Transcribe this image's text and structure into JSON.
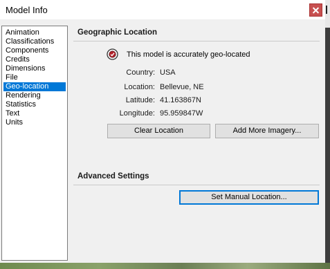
{
  "window": {
    "title": "Model Info"
  },
  "sidebar": {
    "items": [
      {
        "label": "Animation",
        "selected": false
      },
      {
        "label": "Classifications",
        "selected": false
      },
      {
        "label": "Components",
        "selected": false
      },
      {
        "label": "Credits",
        "selected": false
      },
      {
        "label": "Dimensions",
        "selected": false
      },
      {
        "label": "File",
        "selected": false
      },
      {
        "label": "Geo-location",
        "selected": true
      },
      {
        "label": "Rendering",
        "selected": false
      },
      {
        "label": "Statistics",
        "selected": false
      },
      {
        "label": "Text",
        "selected": false
      },
      {
        "label": "Units",
        "selected": false
      }
    ]
  },
  "geo": {
    "header": "Geographic Location",
    "status_icon": "geo-located-badge-icon",
    "status_text": "This model is accurately geo-located",
    "fields": {
      "country_label": "Country:",
      "country_value": "USA",
      "location_label": "Location:",
      "location_value": "Bellevue, NE",
      "latitude_label": "Latitude:",
      "latitude_value": "41.163867N",
      "longitude_label": "Longitude:",
      "longitude_value": "95.959847W"
    },
    "buttons": {
      "clear": "Clear Location",
      "add_imagery": "Add More Imagery..."
    }
  },
  "advanced": {
    "header": "Advanced Settings",
    "set_manual": "Set Manual Location..."
  },
  "colors": {
    "selection": "#0078d7",
    "close_button": "#c75050",
    "window_bg": "#f0f0f0"
  }
}
